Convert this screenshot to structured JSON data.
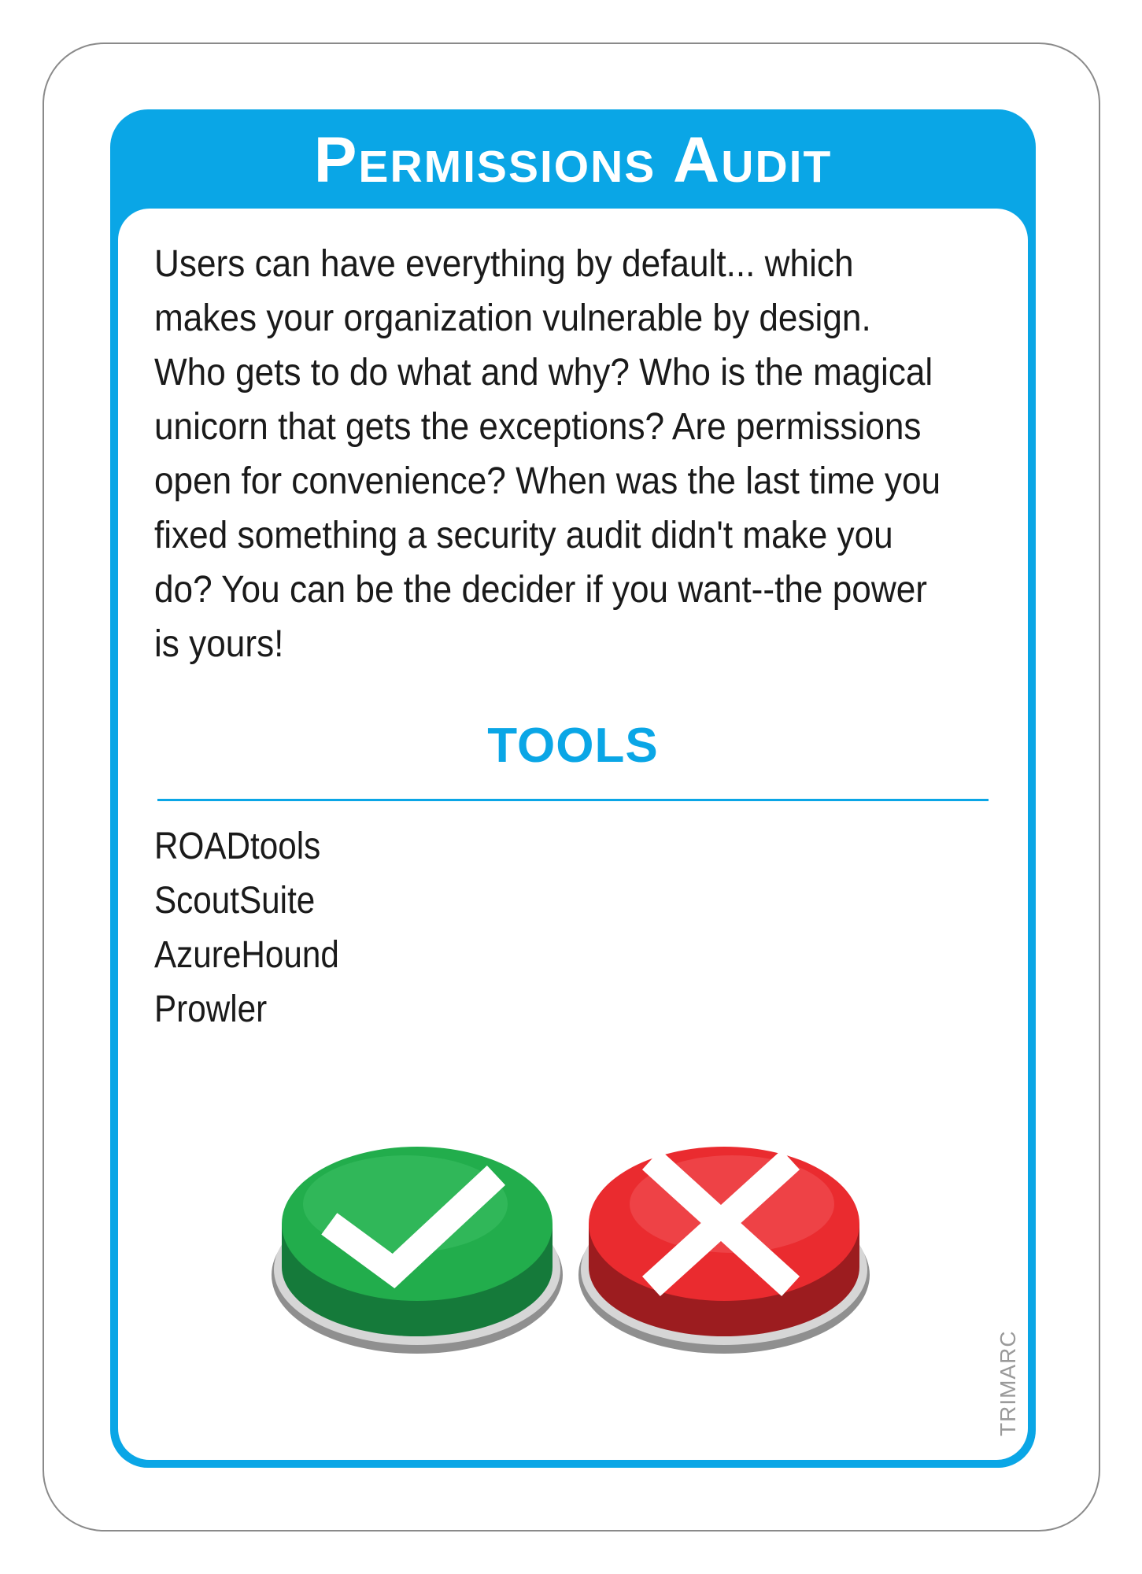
{
  "card": {
    "title": "Permissions Audit",
    "description": "Users can have everything by default... which makes your organization vulnerable by design. Who gets to do what and why? Who is the magical unicorn that gets the exceptions? Are permissions open for convenience? When was the last time you fixed something a security audit didn't make you do? You can be the decider if you want--the power is yours!",
    "tools_heading": "TOOLS",
    "tools": [
      "ROADtools",
      "ScoutSuite",
      "AzureHound",
      "Prowler"
    ],
    "brand": "TRIMARC"
  },
  "buttons": {
    "accept": {
      "icon": "checkmark-icon",
      "color": "#1fa84a"
    },
    "reject": {
      "icon": "x-mark-icon",
      "color": "#e8282b"
    }
  },
  "colors": {
    "accent": "#0aa6e6",
    "card_border": "#8a8a8a",
    "text": "#1a1a1a"
  }
}
